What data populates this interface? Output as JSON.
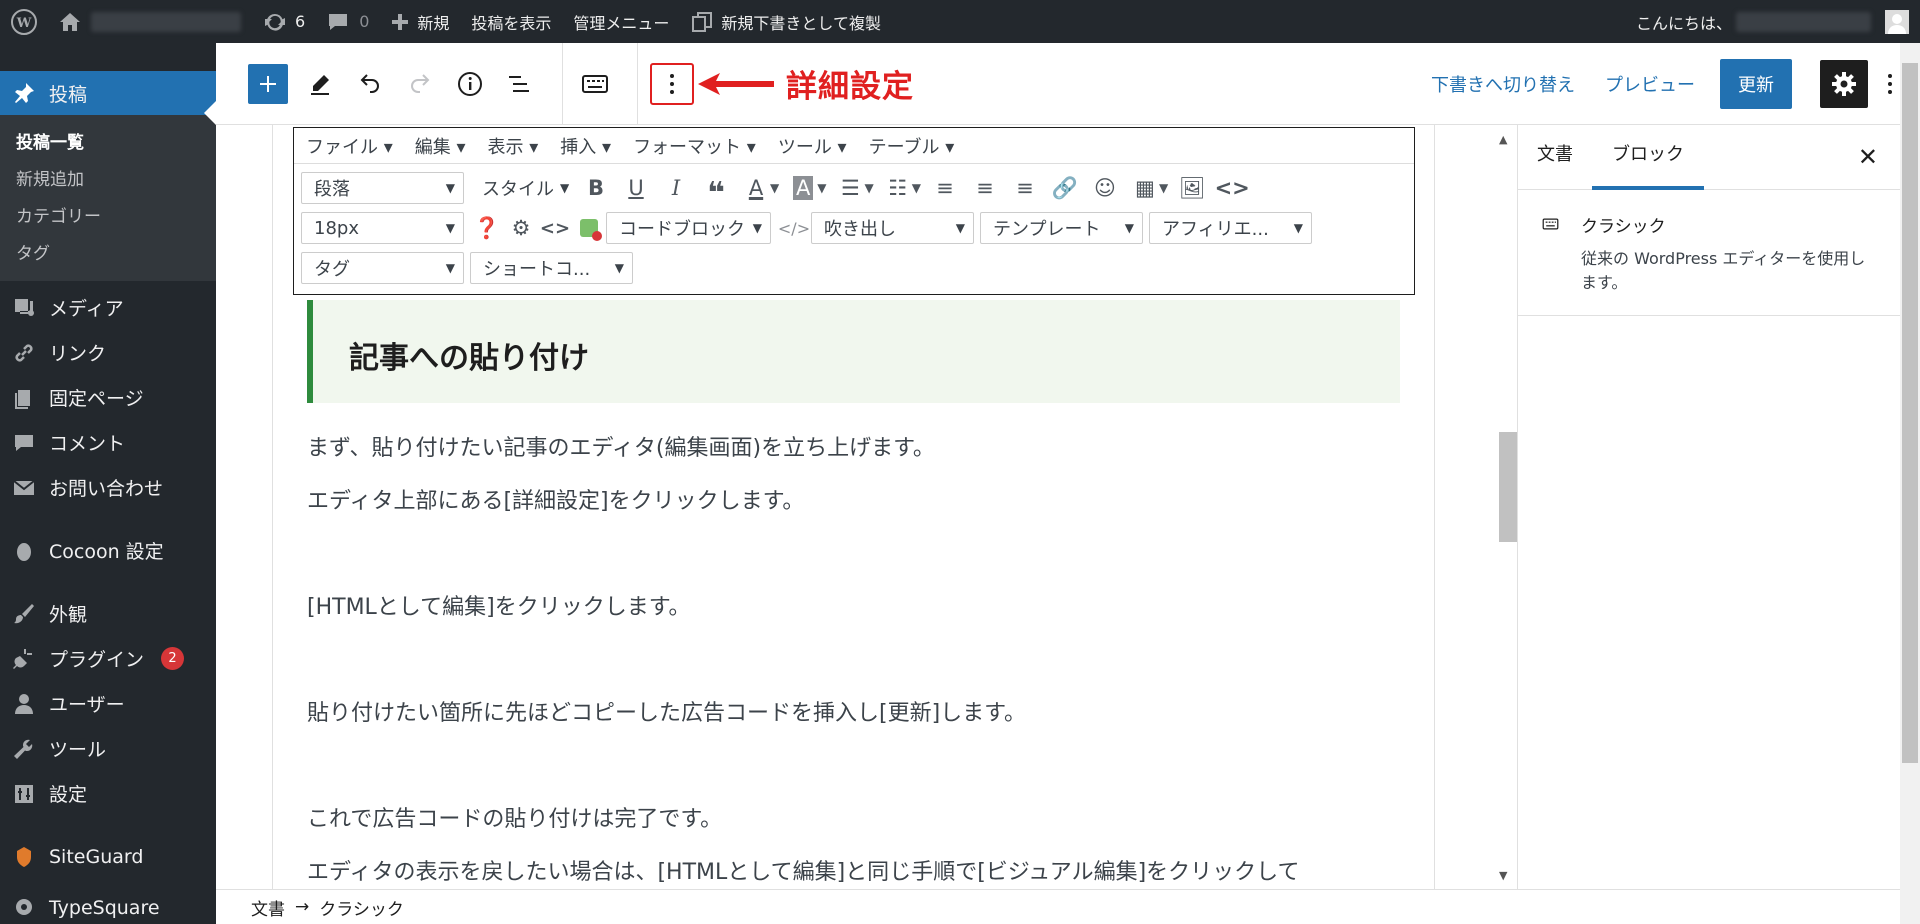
{
  "adminbar": {
    "updates_count": "6",
    "comments_count": "0",
    "new_label": "新規",
    "view_post_label": "投稿を表示",
    "admin_menu_label": "管理メニュー",
    "duplicate_label": "新規下書きとして複製",
    "greeting": "こんにちは、"
  },
  "sidebar": {
    "posts": "投稿",
    "sub": [
      "投稿一覧",
      "新規追加",
      "カテゴリー",
      "タグ"
    ],
    "items": [
      "メディア",
      "リンク",
      "固定ページ",
      "コメント",
      "お問い合わせ",
      "Cocoon 設定",
      "外観",
      "プラグイン",
      "ユーザー",
      "ツール",
      "設定",
      "SiteGuard",
      "TypeSquare Webfonts"
    ],
    "plugin_badge": "2"
  },
  "header": {
    "annotation": "詳細設定",
    "switch_draft": "下書きへ切り替え",
    "preview": "プレビュー",
    "update": "更新"
  },
  "tinymce": {
    "menus": [
      "ファイル ▾",
      "編集 ▾",
      "表示 ▾",
      "挿入 ▾",
      "フォーマット ▾",
      "ツール ▾",
      "テーブル ▾"
    ],
    "format_select": "段落",
    "style_label": "スタイル",
    "size_select": "18px",
    "codeblock": "コードブロック",
    "balloon": "吹き出し",
    "template": "テンプレート",
    "affiliate": "アフィリエ...",
    "tag": "タグ",
    "shortcode": "ショートコ..."
  },
  "content": {
    "heading": "記事への貼り付け",
    "paragraphs": [
      "まず、貼り付けたい記事のエディタ(編集画面)を立ち上げます。",
      "エディタ上部にある[詳細設定]をクリックします。",
      "[HTMLとして編集]をクリックします。",
      "貼り付けたい箇所に先ほどコピーした広告コードを挿入し[更新]します。",
      "これで広告コードの貼り付けは完了です。",
      "エディタの表示を戻したい場合は、[HTMLとして編集]と同じ手順で[ビジュアル編集]をクリックして"
    ]
  },
  "inspector": {
    "tab_document": "文書",
    "tab_block": "ブロック",
    "block_title": "クラシック",
    "block_desc": "従来の WordPress エディターを使用します。"
  },
  "footer": {
    "breadcrumb_doc": "文書",
    "breadcrumb_sep": "→",
    "breadcrumb_block": "クラシック"
  },
  "colors": {
    "accent": "#2271b1",
    "adminbar": "#23282d",
    "annotation": "#e02020",
    "heading_border": "#2e8b3d"
  }
}
